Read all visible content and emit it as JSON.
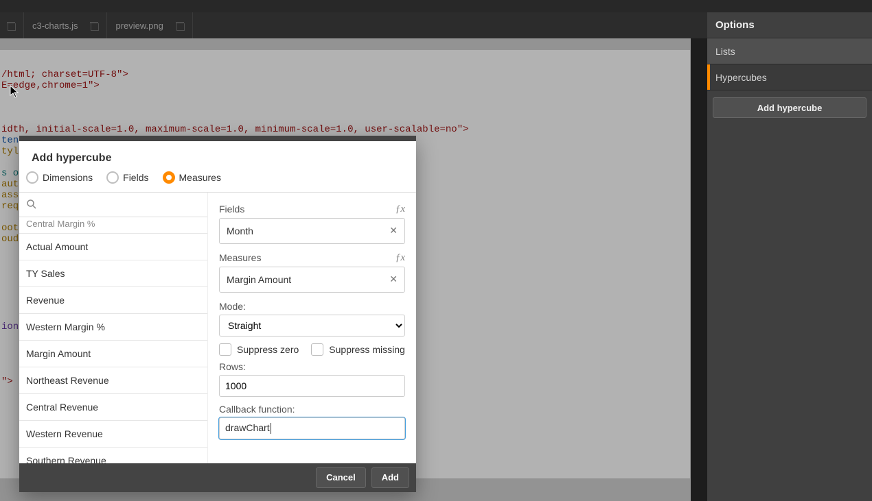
{
  "tabs": [
    {
      "label": "c3-charts.js"
    },
    {
      "label": "preview.png"
    }
  ],
  "rightPanel": {
    "title": "Options",
    "items": [
      {
        "label": "Lists",
        "active": false
      },
      {
        "label": "Hypercubes",
        "active": true
      }
    ],
    "button": "Add hypercube"
  },
  "code": {
    "l1a": "/html; charset=UTF-8\"",
    "l1b": ">",
    "l2a": "E=edge,chrome=1\"",
    "l2b": ">",
    "l6a": "idth, initial-scale=1.0, maximum-scale=1.0, minimum-scale=1.0, user-scalable=no\"",
    "l6b": ">",
    "l7": "ten",
    "l8": "tyl",
    "l10": "s o",
    "l11": "aut",
    "l12": "ass",
    "l13": "req",
    "l15": "oot",
    "l16": "oud",
    "l24": "ion",
    "l29": "\">"
  },
  "modal": {
    "title": "Add hypercube",
    "radios": {
      "dimensions": "Dimensions",
      "fields": "Fields",
      "measures": "Measures"
    },
    "searchPlaceholder": "",
    "measureList": [
      "Central Margin %",
      "Actual Amount",
      "TY Sales",
      "Revenue",
      "Western Margin %",
      "Margin Amount",
      "Northeast Revenue",
      "Central Revenue",
      "Western Revenue",
      "Southern Revenue"
    ],
    "fieldsLabel": "Fields",
    "fieldsValue": "Month",
    "measuresLabel": "Measures",
    "measuresValue": "Margin Amount",
    "modeLabel": "Mode:",
    "modeValue": "Straight",
    "suppressZero": "Suppress zero",
    "suppressMissing": "Suppress missing",
    "rowsLabel": "Rows:",
    "rowsValue": "1000",
    "callbackLabel": "Callback function:",
    "callbackValue": "drawChart",
    "cancel": "Cancel",
    "add": "Add"
  }
}
